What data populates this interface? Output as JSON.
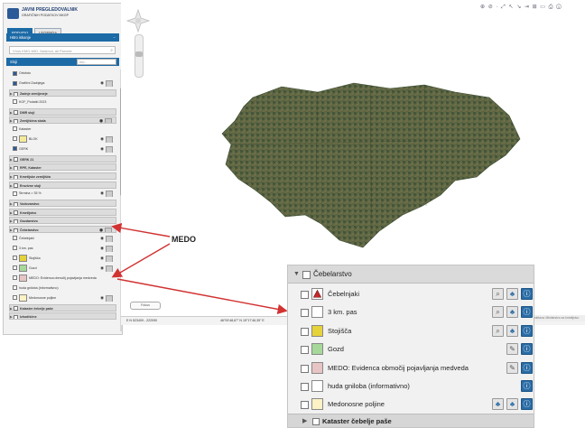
{
  "header": {
    "logo_line1": "JAVNI PREGLEDOVALNIK",
    "logo_line2": "GRAFIČNIH PODATKOV MKGP",
    "tabs": [
      {
        "label": "PODATKI"
      },
      {
        "label": "LEGENDA"
      }
    ]
  },
  "search_panel": {
    "title": "Hitro iskanje",
    "placeholder": "Vnos KMG-MID, Naslova, ali Parcele"
  },
  "layers_panel": {
    "title": "Sloji",
    "selector_placeholder": "Išči...",
    "rows": [
      {
        "label": "Ortofoto",
        "kind": "check"
      },
      {
        "label": "Grafični Zadnjega",
        "kind": "check"
      },
      {
        "label": "Zadnje zemljeneje",
        "kind": "group"
      },
      {
        "label": "KGF_Podatki 2023",
        "kind": "item"
      },
      {
        "label": "DMR sloji",
        "kind": "group"
      },
      {
        "label": "Zemljiščna skala",
        "kind": "group"
      },
      {
        "label": "Kataster",
        "kind": "item"
      },
      {
        "label": "BLOK",
        "kind": "item"
      },
      {
        "label": "GERK",
        "kind": "item"
      },
      {
        "label": "GERK 21",
        "kind": "group"
      },
      {
        "label": "RPE, Kataster",
        "kind": "group"
      },
      {
        "label": "Kmetijske zemljišča",
        "kind": "group"
      },
      {
        "label": "Erozivne sloji",
        "kind": "group"
      },
      {
        "label": "Strmina > 35 %",
        "kind": "item"
      },
      {
        "label": "Vodovarstvo",
        "kind": "group"
      },
      {
        "label": "Kmetijstvo",
        "kind": "group"
      },
      {
        "label": "Gozdarstvo",
        "kind": "group"
      },
      {
        "label": "Čebelarstvo",
        "kind": "group"
      },
      {
        "label": "Čebelnjaki",
        "kind": "item"
      },
      {
        "label": "3 km. pas",
        "kind": "item"
      },
      {
        "label": "Stojišča",
        "kind": "item"
      },
      {
        "label": "Gozd",
        "kind": "item"
      },
      {
        "label": "MEDO: Evidenca območij pojavljanja medveda",
        "kind": "item"
      },
      {
        "label": "huda gniloba (informativno)",
        "kind": "item"
      },
      {
        "label": "Medonosne poljine",
        "kind": "item"
      },
      {
        "label": "Kataster čebelje paše",
        "kind": "group"
      },
      {
        "label": "Izhodiščne",
        "kind": "group"
      }
    ]
  },
  "map": {
    "toolbar_glyphs": "⊕ ⊘ · ⤢ ↖ ↘ ⇥ ⊞ ▭ ⎙ ⓘ",
    "status_left": "E N 523409 - 222090",
    "status_mid": "46°09'48,67\" N 15°17'46,35\" E",
    "small_button": "Fokus",
    "right_strip": "Izdelava: Ministrstvo za kmetijstvo"
  },
  "annotation": {
    "label": "MEDO"
  },
  "zoom_panel": {
    "header": "Čebelarstvo",
    "rows": [
      {
        "label": "Čebelnjaki",
        "swatch": "#ffffff",
        "triangle": true,
        "buttons": [
          "zoom",
          "tree",
          "info"
        ]
      },
      {
        "label": "3 km. pas",
        "swatch": "#ffffff",
        "triangle": false,
        "buttons": [
          "zoom",
          "tree",
          "info"
        ]
      },
      {
        "label": "Stojišča",
        "swatch": "#e6d23a",
        "triangle": false,
        "buttons": [
          "zoom",
          "tree",
          "info"
        ]
      },
      {
        "label": "Gozd",
        "swatch": "#a6d89a",
        "triangle": false,
        "buttons": [
          "edit",
          "info"
        ]
      },
      {
        "label": "MEDO: Evidenca območij pojavljanja medveda",
        "swatch": "#e7c5c5",
        "triangle": false,
        "buttons": [
          "edit",
          "info"
        ]
      },
      {
        "label": "huda gniloba (informativno)",
        "swatch": "#ffffff",
        "triangle": false,
        "buttons": [
          "info"
        ]
      },
      {
        "label": "Medonosne poljine",
        "swatch": "#fdf1c6",
        "triangle": false,
        "buttons": [
          "tree",
          "tree",
          "info"
        ]
      }
    ],
    "footer": "Kataster čebelje paše"
  },
  "colors": {
    "accent": "#1c6aa6",
    "arrow": "#d23232"
  }
}
